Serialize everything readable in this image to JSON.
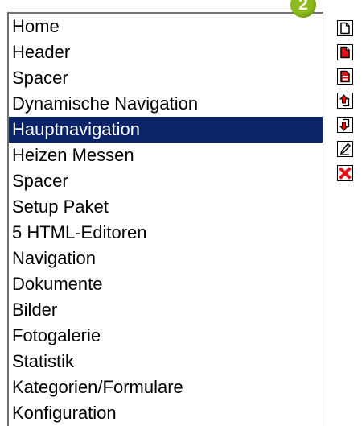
{
  "badge": {
    "number": "2"
  },
  "list": {
    "selected_index": 4,
    "items": [
      "Home",
      "Header",
      "Spacer",
      "Dynamische Navigation",
      "Hauptnavigation",
      "Heizen Messen",
      "Spacer",
      "Setup Paket",
      "5 HTML-Editoren",
      "Navigation",
      "Dokumente",
      "Bilder",
      "Fotogalerie",
      "Statistik",
      "Kategorien/Formulare",
      "Konfiguration"
    ]
  },
  "toolbar": {
    "buttons": [
      {
        "icon": "new-page-icon"
      },
      {
        "icon": "new-page-red-icon"
      },
      {
        "icon": "edit-page-red-icon"
      },
      {
        "icon": "move-up-icon"
      },
      {
        "icon": "move-down-icon"
      },
      {
        "icon": "rename-pencil-icon"
      },
      {
        "icon": "delete-icon"
      }
    ]
  },
  "colors": {
    "selection": "#0a2469",
    "badge": "#8dbb1c",
    "icon_red": "#e0141c"
  }
}
